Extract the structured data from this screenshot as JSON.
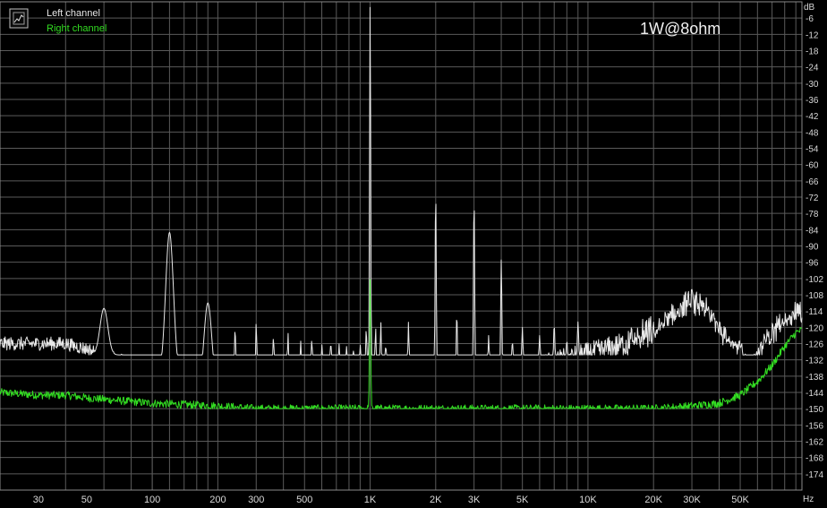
{
  "chart_data": {
    "type": "line",
    "title": "",
    "annotation": "1W@8ohm",
    "xlabel": "",
    "ylabel": "",
    "x_unit": "Hz",
    "y_unit": "dB",
    "x_scale": "log",
    "xlim": [
      20,
      96000
    ],
    "ylim": [
      -180,
      0
    ],
    "grid": true,
    "legend_position": "top-left",
    "y_ticks": [
      -6,
      -12,
      -18,
      -24,
      -30,
      -36,
      -42,
      -48,
      -54,
      -60,
      -66,
      -72,
      -78,
      -84,
      -90,
      -96,
      -102,
      -108,
      -114,
      -120,
      -126,
      -132,
      -138,
      -144,
      -150,
      -156,
      -162,
      -168,
      -174
    ],
    "x_ticks": [
      {
        "value": 30,
        "label": "30"
      },
      {
        "value": 50,
        "label": "50"
      },
      {
        "value": 100,
        "label": "100"
      },
      {
        "value": 200,
        "label": "200"
      },
      {
        "value": 300,
        "label": "300"
      },
      {
        "value": 500,
        "label": "500"
      },
      {
        "value": 1000,
        "label": "1K"
      },
      {
        "value": 2000,
        "label": "2K"
      },
      {
        "value": 3000,
        "label": "3K"
      },
      {
        "value": 5000,
        "label": "5K"
      },
      {
        "value": 10000,
        "label": "10K"
      },
      {
        "value": 20000,
        "label": "20K"
      },
      {
        "value": 30000,
        "label": "30K"
      },
      {
        "value": 50000,
        "label": "50K"
      }
    ],
    "series": [
      {
        "name": "Left channel",
        "color": "#e8e8e8",
        "floor": [
          [
            20,
            -126
          ],
          [
            30,
            -126
          ],
          [
            40,
            -126
          ],
          [
            50,
            -128
          ],
          [
            70,
            -132
          ],
          [
            90,
            -134
          ],
          [
            120,
            -138
          ],
          [
            150,
            -142
          ],
          [
            200,
            -144
          ],
          [
            300,
            -145
          ],
          [
            500,
            -145
          ],
          [
            700,
            -144
          ],
          [
            1000,
            -144
          ],
          [
            2000,
            -142
          ],
          [
            3000,
            -140
          ],
          [
            5000,
            -137
          ],
          [
            7000,
            -133
          ],
          [
            10000,
            -130
          ],
          [
            15000,
            -126
          ],
          [
            20000,
            -122
          ],
          [
            25000,
            -115
          ],
          [
            30000,
            -110
          ],
          [
            35000,
            -114
          ],
          [
            40000,
            -120
          ],
          [
            50000,
            -128
          ],
          [
            55000,
            -136
          ],
          [
            60000,
            -130
          ],
          [
            70000,
            -122
          ],
          [
            80000,
            -117
          ],
          [
            90000,
            -114
          ],
          [
            96000,
            -115
          ]
        ],
        "peaks": [
          [
            60,
            -113
          ],
          [
            120,
            -85
          ],
          [
            180,
            -111
          ],
          [
            240,
            -120
          ],
          [
            300,
            -118
          ],
          [
            360,
            -123
          ],
          [
            420,
            -122
          ],
          [
            480,
            -125
          ],
          [
            540,
            -124
          ],
          [
            600,
            -126
          ],
          [
            660,
            -125
          ],
          [
            720,
            -126
          ],
          [
            780,
            -127
          ],
          [
            840,
            -128
          ],
          [
            900,
            -126
          ],
          [
            960,
            -120
          ],
          [
            1000,
            -1
          ],
          [
            1060,
            -120
          ],
          [
            1120,
            -118
          ],
          [
            1180,
            -126
          ],
          [
            1500,
            -118
          ],
          [
            2000,
            -70
          ],
          [
            2500,
            -115
          ],
          [
            3000,
            -72
          ],
          [
            3500,
            -123
          ],
          [
            4000,
            -95
          ],
          [
            4500,
            -125
          ],
          [
            5000,
            -120
          ],
          [
            6000,
            -123
          ],
          [
            7000,
            -119
          ],
          [
            8000,
            -125
          ],
          [
            9000,
            -118
          ]
        ]
      },
      {
        "name": "Right channel",
        "color": "#33dd22",
        "floor": [
          [
            20,
            -144
          ],
          [
            30,
            -145
          ],
          [
            40,
            -145
          ],
          [
            50,
            -146
          ],
          [
            70,
            -147
          ],
          [
            100,
            -148
          ],
          [
            200,
            -149
          ],
          [
            300,
            -150
          ],
          [
            500,
            -150
          ],
          [
            1000,
            -150
          ],
          [
            2000,
            -150
          ],
          [
            3000,
            -150
          ],
          [
            5000,
            -150
          ],
          [
            10000,
            -150
          ],
          [
            20000,
            -150
          ],
          [
            30000,
            -149
          ],
          [
            40000,
            -148
          ],
          [
            50000,
            -145
          ],
          [
            60000,
            -140
          ],
          [
            70000,
            -134
          ],
          [
            80000,
            -127
          ],
          [
            90000,
            -122
          ],
          [
            96000,
            -121
          ]
        ],
        "peaks": [
          [
            1000,
            -102
          ]
        ]
      }
    ]
  }
}
